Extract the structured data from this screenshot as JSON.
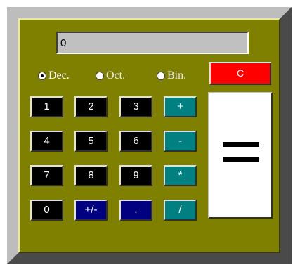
{
  "display": {
    "value": "0"
  },
  "modes": [
    {
      "label": "Dec.",
      "checked": true
    },
    {
      "label": "Oct.",
      "checked": false
    },
    {
      "label": "Bin.",
      "checked": false
    }
  ],
  "buttons": {
    "clear": "C",
    "equals": "=",
    "digits": {
      "d0": "0",
      "d1": "1",
      "d2": "2",
      "d3": "3",
      "d4": "4",
      "d5": "5",
      "d6": "6",
      "d7": "7",
      "d8": "8",
      "d9": "9"
    },
    "sign": "+/-",
    "decimal": ".",
    "add": "+",
    "subtract": "-",
    "multiply": "*",
    "divide": "/"
  },
  "colors": {
    "panel": "#808000",
    "digit_button": "#000000",
    "sign_decimal_button": "#000080",
    "operator_button": "#008080",
    "clear_button": "#ff0000",
    "equals_button": "#ffffff",
    "display_background": "#c0c0c0"
  }
}
